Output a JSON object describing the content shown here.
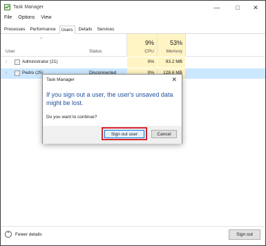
{
  "window": {
    "title": "Task Manager",
    "controls": {
      "minimize": "—",
      "maximize": "□",
      "close": "✕"
    }
  },
  "menu": [
    "File",
    "Options",
    "View"
  ],
  "tabs": [
    "Processes",
    "Performance",
    "Users",
    "Details",
    "Services"
  ],
  "active_tab": "Users",
  "columns": {
    "sort_indicator": "^",
    "user": "User",
    "status": "Status",
    "cpu_total": "9%",
    "cpu_label": "CPU",
    "memory_total": "53%",
    "memory_label": "Memory"
  },
  "rows": [
    {
      "expand": "›",
      "name": "Administrator (21)",
      "status": "",
      "cpu": "0%",
      "memory": "93.2 MB"
    },
    {
      "expand": "›",
      "name": "Pedro (25)",
      "status": "Disconnected",
      "cpu": "0%",
      "memory": "128.6 MB"
    }
  ],
  "footer": {
    "fewer_details": "Fewer details",
    "fewer_icon": "⌃",
    "sign_out": "Sign out"
  },
  "dialog": {
    "title": "Task Manager",
    "close": "✕",
    "message": "If you sign out a user, the user's unsaved data might be lost.",
    "question": "Do you want to continue?",
    "primary_button": "Sign out user",
    "cancel_button": "Cancel",
    "highlight_color": "#d8232a"
  },
  "colors": {
    "accent": "#0078d7",
    "usage_highlight": "#fff4c4",
    "message_text": "#1e4e9c"
  }
}
